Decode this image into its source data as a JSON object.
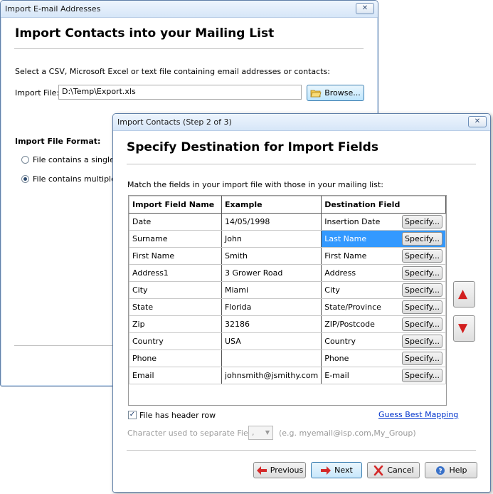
{
  "back_window": {
    "title": "Import E-mail Addresses",
    "close_label": "✕",
    "heading": "Import Contacts into your Mailing List",
    "description": "Select a CSV, Microsoft Excel or text file containing email addresses or contacts:",
    "import_file_label": "Import File:",
    "import_file_value": "D:\\Temp\\Export.xls",
    "browse_label": "Browse...",
    "format_label": "Import File Format:",
    "option_single": "File contains a single co",
    "option_multiple": "File contains multiple co"
  },
  "dialog": {
    "title": "Import Contacts (Step 2 of 3)",
    "close_label": "✕",
    "heading": "Specify Destination for Import Fields",
    "instruction": "Match the fields in your import file with those in your mailing list:",
    "columns": [
      "Import Field Name",
      "Example",
      "Destination Field"
    ],
    "rows": [
      {
        "field": "Date",
        "example": "14/05/1998",
        "dest": "Insertion Date",
        "specify": "Specify..."
      },
      {
        "field": "Surname",
        "example": "John",
        "dest": "Last Name",
        "specify": "Specify..."
      },
      {
        "field": "First Name",
        "example": "Smith",
        "dest": "First Name",
        "specify": "Specify..."
      },
      {
        "field": "Address1",
        "example": "3 Grower Road",
        "dest": "Address",
        "specify": "Specify..."
      },
      {
        "field": "City",
        "example": "Miami",
        "dest": "City",
        "specify": "Specify..."
      },
      {
        "field": "State",
        "example": "Florida",
        "dest": "State/Province",
        "specify": "Specify..."
      },
      {
        "field": "Zip",
        "example": "32186",
        "dest": "ZIP/Postcode",
        "specify": "Specify..."
      },
      {
        "field": "Country",
        "example": "USA",
        "dest": "Country",
        "specify": "Specify..."
      },
      {
        "field": "Phone",
        "example": "",
        "dest": "Phone",
        "specify": "Specify..."
      },
      {
        "field": "Email",
        "example": "johnsmith@jsmithy.com",
        "dest": "E-mail",
        "specify": "Specify..."
      }
    ],
    "selected_row": 1,
    "header_row_label": "File has header row",
    "guess_mapping_label": "Guess Best Mapping",
    "separator_label": "Character used to separate Fields:",
    "separator_value": ",",
    "separator_hint": "(e.g. myemail@isp.com,My_Group)",
    "buttons": {
      "previous": "Previous",
      "next": "Next",
      "cancel": "Cancel",
      "help": "Help"
    }
  },
  "colors": {
    "selection": "#3399ff",
    "link": "#0033cc",
    "arrow": "#d21f1f"
  }
}
